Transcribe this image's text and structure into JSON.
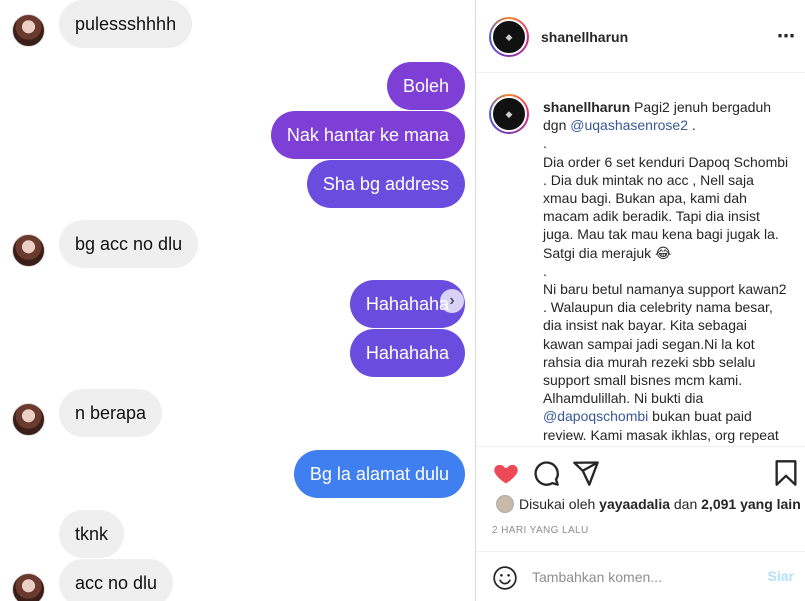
{
  "chat": {
    "messages": [
      {
        "side": "in",
        "text": "pulessshhhh"
      },
      {
        "side": "out",
        "text": "Boleh"
      },
      {
        "side": "out",
        "text": "Nak hantar ke mana"
      },
      {
        "side": "out",
        "text": "Sha bg address"
      },
      {
        "side": "in",
        "text": "bg acc no dlu"
      },
      {
        "side": "out",
        "text": "Hahahaha"
      },
      {
        "side": "out",
        "text": "Hahahaha"
      },
      {
        "side": "in",
        "text": "n berapa"
      },
      {
        "side": "out",
        "text": "Bg la alamat dulu"
      },
      {
        "side": "in",
        "text": "tknk"
      },
      {
        "side": "in",
        "text": "acc no dlu"
      }
    ],
    "forward_icon": "chevron-right-icon",
    "colors": {
      "purple": "#7e3fd6",
      "violet": "#6a4ddf",
      "blue": "#3f7ff0",
      "incoming": "#efefef"
    }
  },
  "post": {
    "username": "shanellharun",
    "more_icon": "⋯",
    "caption": {
      "username": "shanellharun",
      "line1": "Pagi2 jenuh bergaduh dgn ",
      "mention1": "@uqashasenrose2",
      "line1_end": " .",
      "dot1": ".",
      "para1": "Dia order 6 set kenduri Dapoq Schombi . Dia duk mintak no acc , Nell saja xmau bagi. Bukan apa, kami dah macam adik beradik. Tapi dia insist juga. Mau tak mau kena bagi jugak la. Satgi dia merajuk 😂",
      "dot2": ".",
      "para2": "Ni baru betul namanya support kawan2 . Walaupun dia celebrity nama besar, dia insist nak bayar. Kita sebagai kawan sampai jadi segan.Ni la kot rahsia dia murah rezeki sbb selalu support small bisnes mcm kami. Alhamdulillah. Ni bukti dia ",
      "mention2": "@dapoqschombi",
      "para2_end": " bukan buat paid review. Kami masak ikhlas, org repeat"
    },
    "actions": {
      "like_icon": "heart-icon",
      "comment_icon": "comment-icon",
      "share_icon": "paper-plane-icon",
      "save_icon": "bookmark-icon",
      "like_color": "#ed4956"
    },
    "likes": {
      "prefix": "Disukai oleh ",
      "liker": "yayaadalia",
      "middle": " dan ",
      "count": "2,091 yang lain"
    },
    "date": "2 HARI YANG LALU",
    "comment": {
      "placeholder": "Tambahkan komen...",
      "post_label": "Siar"
    }
  }
}
